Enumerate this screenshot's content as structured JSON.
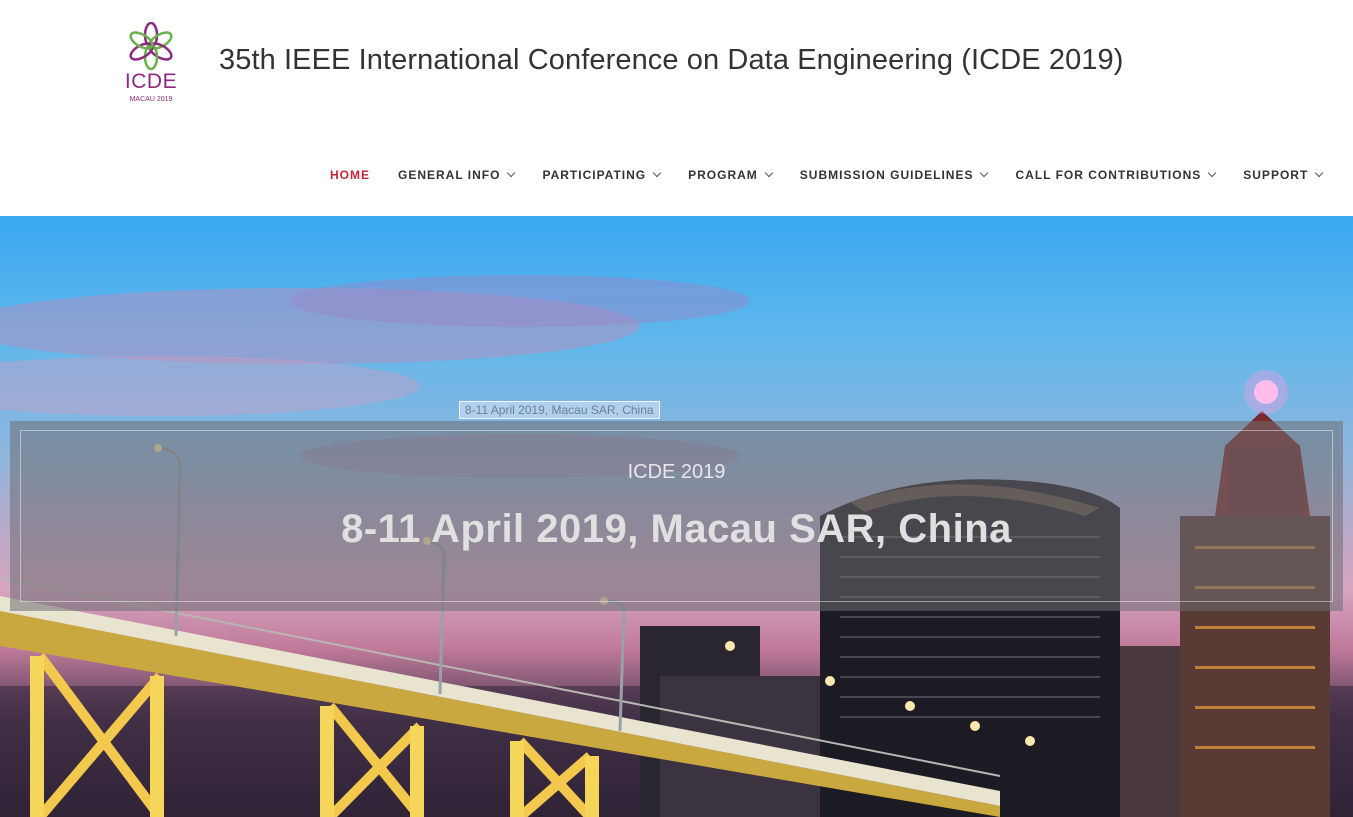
{
  "header": {
    "logo_text": "ICDE",
    "logo_sub": "MACAU 2019",
    "title": "35th IEEE International Conference on Data Engineering (ICDE 2019)"
  },
  "nav": {
    "items": [
      {
        "label": "HOME",
        "active": true,
        "dropdown": false
      },
      {
        "label": "GENERAL INFO",
        "active": false,
        "dropdown": true
      },
      {
        "label": "PARTICIPATING",
        "active": false,
        "dropdown": true
      },
      {
        "label": "PROGRAM",
        "active": false,
        "dropdown": true
      },
      {
        "label": "SUBMISSION GUIDELINES",
        "active": false,
        "dropdown": true
      },
      {
        "label": "CALL FOR CONTRIBUTIONS",
        "active": false,
        "dropdown": true
      },
      {
        "label": "SUPPORT",
        "active": false,
        "dropdown": true
      }
    ],
    "active_color": "#c0263a"
  },
  "hero": {
    "badge": "8-11 April 2019, Macau SAR, China",
    "subtitle": "ICDE 2019",
    "title": "8-11 April 2019, Macau SAR, China"
  },
  "colors": {
    "logo_purple": "#8e2a7e",
    "logo_green": "#6ab04c"
  }
}
